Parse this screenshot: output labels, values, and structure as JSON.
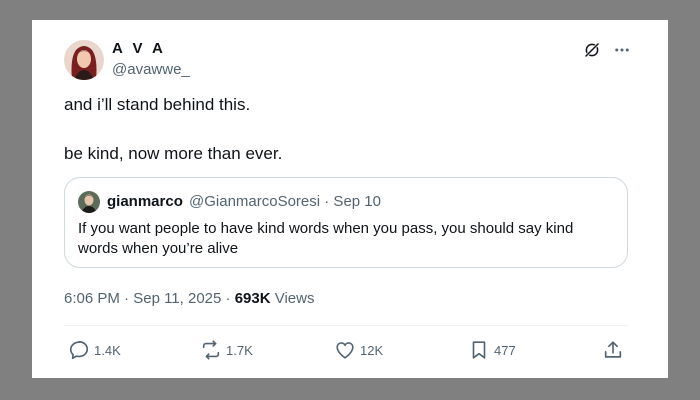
{
  "tweet": {
    "display_name": "A V A",
    "handle": "@avawwe_",
    "text_line1": "and i’ll stand behind this.",
    "text_line2": "be kind, now more than ever.",
    "time": "6:06 PM",
    "date": "Sep 11, 2025",
    "views_count": "693K",
    "views_label": "Views",
    "separator": "·"
  },
  "quote": {
    "display_name": "gianmarco",
    "handle_and_date": "@GianmarcoSoresi · Sep 10",
    "text": "If you want people to have kind words when you pass, you should say kind words when you’re alive"
  },
  "actions": {
    "replies": "1.4K",
    "reposts": "1.7K",
    "likes": "12K",
    "bookmarks": "477"
  },
  "icons": {
    "grok": "grok-icon",
    "more": "more-icon",
    "reply": "reply-icon",
    "repost": "repost-icon",
    "like": "heart-icon",
    "bookmark": "bookmark-icon",
    "share": "share-icon"
  },
  "colors": {
    "background": "#808080",
    "card": "#ffffff",
    "text_primary": "#0f1419",
    "text_secondary": "#536471",
    "border": "#cfd9de"
  }
}
